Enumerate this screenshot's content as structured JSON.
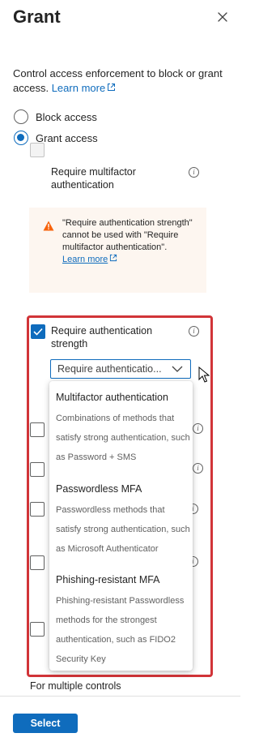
{
  "panel": {
    "title": "Grant",
    "description": "Control access enforcement to block or grant access.",
    "learn_more": "Learn more"
  },
  "access_options": [
    {
      "label": "Block access",
      "selected": false
    },
    {
      "label": "Grant access",
      "selected": true
    }
  ],
  "controls": {
    "require_mfa": {
      "label": "Require multifactor authentication",
      "checked": false,
      "disabled": true
    },
    "warning": {
      "text": "\"Require authentication strength\" cannot be used with \"Require multifactor authentication\".",
      "learn_more": "Learn more"
    },
    "require_auth_strength": {
      "label": "Require authentication strength",
      "checked": true
    },
    "strength_select": {
      "value": "Require authenticatio..."
    }
  },
  "dropdown_options": [
    {
      "title": "Multifactor authentication",
      "description": "Combinations of methods that satisfy strong authentication, such as Password + SMS"
    },
    {
      "title": "Passwordless MFA",
      "description": "Passwordless methods that satisfy strong authentication, such as Microsoft Authenticator"
    },
    {
      "title": "Phishing-resistant MFA",
      "description": "Phishing-resistant Passwordless methods for the strongest authentication, such as FIDO2 Security Key"
    }
  ],
  "footer": {
    "multiple_controls": "For multiple controls",
    "select_button": "Select"
  },
  "colors": {
    "accent": "#0f6cbd",
    "highlight": "#d13438",
    "warning_bg": "#fdf6f0",
    "warning_icon": "#f7630c"
  }
}
